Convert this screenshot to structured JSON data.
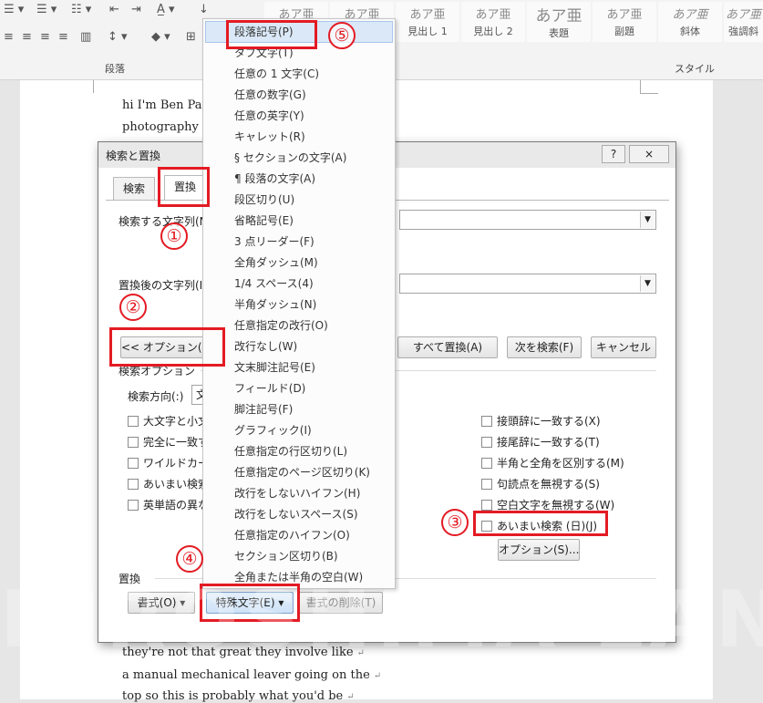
{
  "ribbon": {
    "group_paragraph": "段落",
    "group_style": "スタイル",
    "styles": [
      {
        "sample": "あア亜",
        "name": ""
      },
      {
        "sample": "あア亜",
        "name": ""
      },
      {
        "sample": "あア亜",
        "name": "見出し 1"
      },
      {
        "sample": "あア亜",
        "name": "見出し 2"
      },
      {
        "sample": "あア亜",
        "name": "表題"
      },
      {
        "sample": "あア亜",
        "name": "副題"
      },
      {
        "sample": "あア亜",
        "name": "斜体"
      },
      {
        "sample": "あア亜",
        "name": "強調斜"
      }
    ]
  },
  "document": {
    "line1": "hi I'm Ben Pas",
    "line2": "photography ca",
    "line3": "they're not that great they involve like",
    "line4": "a manual mechanical leaver going on the",
    "line5": "top so this is probably what you'd be",
    "para_mark": "↵"
  },
  "dialog": {
    "title": "検索と置換",
    "help": "?",
    "close": "×",
    "tab_search": "検索",
    "tab_replace": "置換",
    "find_label": "検索する文字列(N",
    "replace_label": "置換後の文字列(I",
    "options_button": "<< オプション(L)",
    "replace_all_button": "すべて置換(A)",
    "find_next_button": "次を検索(F)",
    "cancel_button": "キャンセル",
    "search_options_label": "検索オプション",
    "direction_label": "検索方向(:)",
    "direction_value": "文",
    "left_checks": [
      "大文字と小文",
      "完全に一致す",
      "ワイルドカード",
      "あいまい検索",
      "英単語の異な"
    ],
    "right_checks": [
      "接頭辞に一致する(X)",
      "接尾辞に一致する(T)",
      "半角と全角を区別する(M)",
      "句読点を無視する(S)",
      "空白文字を無視する(W)",
      "あいまい検索 (日)(J)"
    ],
    "fuzzy_options_button": "オプション(S)...",
    "replace_section_label": "置換",
    "format_button": "書式(O)",
    "special_button": "特殊文字(E)",
    "no_format_button": "書式の削除(T)"
  },
  "menu": {
    "items": [
      "段落記号(P)",
      "タブ文字(T)",
      "任意の 1 文字(C)",
      "任意の数字(G)",
      "任意の英字(Y)",
      "キャレット(R)",
      "§ セクションの文字(A)",
      "¶ 段落の文字(A)",
      "段区切り(U)",
      "省略記号(E)",
      "3 点リーダー(F)",
      "全角ダッシュ(M)",
      "1/4 スペース(4)",
      "半角ダッシュ(N)",
      "任意指定の改行(O)",
      "改行なし(W)",
      "文末脚注記号(E)",
      "フィールド(D)",
      "脚注記号(F)",
      "グラフィック(I)",
      "任意指定の行区切り(L)",
      "任意指定のページ区切り(K)",
      "改行をしないハイフン(H)",
      "改行をしないスペース(S)",
      "任意指定のハイフン(O)",
      "セクション区切り(B)",
      "全角または半角の空白(W)"
    ]
  },
  "annotations": [
    "①",
    "②",
    "③",
    "④",
    "⑤"
  ],
  "watermark": "HIROSHIMA LAND",
  "colors": {
    "annotation": "#e31b23",
    "menu_highlight": "#dbe8f7"
  }
}
